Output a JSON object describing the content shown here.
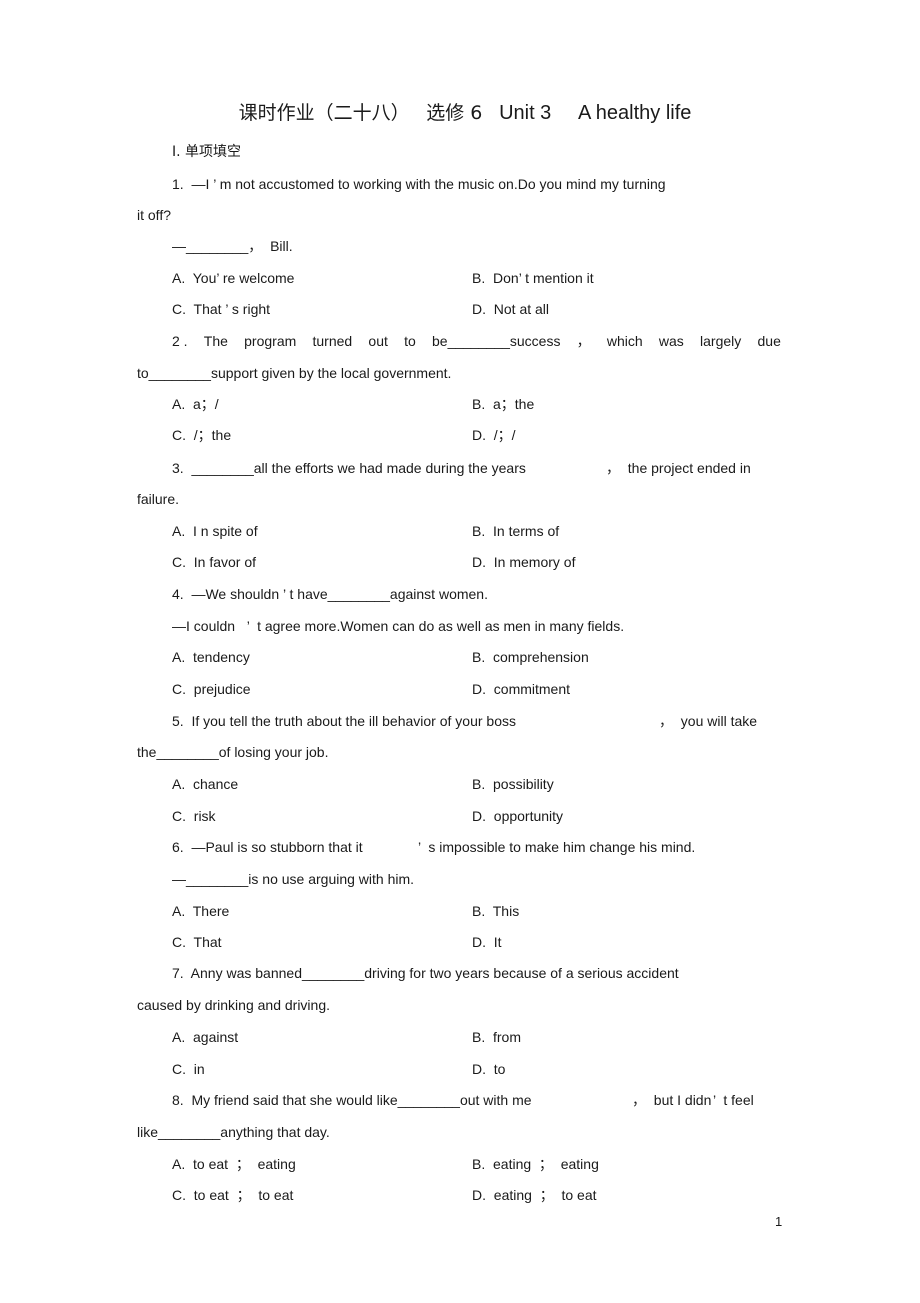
{
  "header": {
    "title_cn": "课时作业（二十八）",
    "title_module": "选修 6",
    "title_unit": "Unit 3",
    "title_topic": "A healthy life"
  },
  "section": {
    "label": "Ⅰ. 单项填空"
  },
  "questions": [
    {
      "lines": [
        "1.  —I ’ m not accustomed to working with the music on.Do you mind my turning",
        "it off?",
        "—________，  Bill."
      ],
      "options": [
        "A.  You’ re welcome",
        "B.  Don’ t mention it",
        "C.  That ’ s right",
        "D.  Not at all"
      ]
    },
    {
      "lines": [
        "2 .",
        "The",
        "program",
        "turned",
        "out",
        "to",
        "be________success",
        "，",
        "which",
        "was",
        "largely",
        "due",
        "to________support given by the local government."
      ],
      "options": [
        "A.  a；/",
        "B.  a；the",
        "C.  /；the",
        "D.  /；/"
      ]
    },
    {
      "lines": [
        "3.  ________all the efforts we had made during the years",
        "，  the project ended in",
        "failure."
      ],
      "options": [
        "A.  I n spite of",
        "B.  In terms of",
        "C.  In favor of",
        "D.  In memory of"
      ]
    },
    {
      "lines": [
        "4.  —We shouldn ’ t have________against women.",
        "—I couldn   ’  t agree more.Women can do as well as men in many fields."
      ],
      "options": [
        "A.  tendency",
        "B.  comprehension",
        "C.  prejudice",
        "D.  commitment"
      ]
    },
    {
      "lines": [
        "5.  If you tell the truth about the ill behavior of your boss",
        "，  you will take",
        "the________of losing your job."
      ],
      "options": [
        "A.  chance",
        "B.  possibility",
        "C.  risk",
        "D.  opportunity"
      ]
    },
    {
      "lines": [
        "6.  —Paul is so stubborn that it",
        "’  s impossible to make him change his mind.",
        "—________is no use arguing with him."
      ],
      "options": [
        "A.  There",
        "B.  This",
        "C.  That",
        "D.  It"
      ]
    },
    {
      "lines": [
        "7.  Anny was banned________driving for two years because of a serious accident",
        "caused by drinking and driving."
      ],
      "options": [
        "A.  against",
        "B.  from",
        "C.  in",
        "D.  to"
      ]
    },
    {
      "lines": [
        "8.  My friend said that she would like________out with me",
        "，  but I didn",
        "’  t feel",
        "like________anything that day."
      ],
      "options": [
        "A.  to eat  ；  eating",
        "B.  eating  ；  eating",
        "C.  to eat  ；  to eat",
        "D.  eating  ；  to eat"
      ]
    }
  ],
  "footer": {
    "page_number": "1"
  }
}
